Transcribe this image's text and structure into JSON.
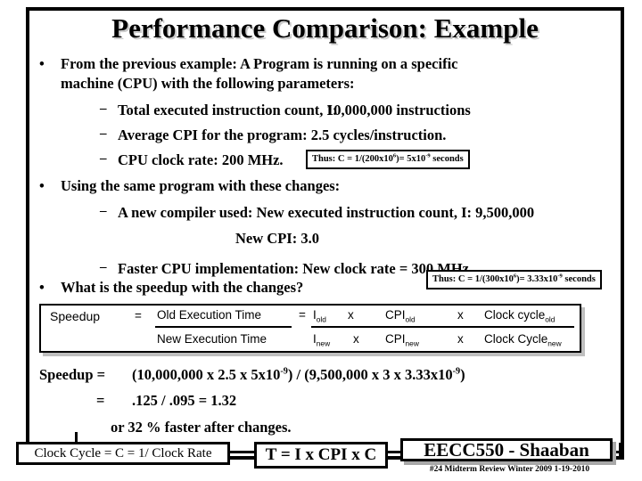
{
  "slide": {
    "title": "Performance Comparison: Example",
    "bullets": {
      "b1": "From the previous example:  A Program is running on a specific",
      "b1_line2": "machine (CPU) with the following parameters:",
      "d1": "Total executed instruction count, I:",
      "d1_value": "10,000,000 instructions",
      "d2": "Average CPI for the program:  2.5  cycles/instruction.",
      "d3": "CPU clock rate:  200 MHz.",
      "b2": "Using the same program with these changes:",
      "d4": "A new compiler used:  New executed instruction count, I:  9,500,000",
      "d4_line2": "New CPI:  3.0",
      "d5": "Faster CPU implementation:  New clock rate = 300 MHz",
      "b3": "What is the speedup with the changes?"
    },
    "dash": "–",
    "bullet_glyph": "•",
    "callouts": {
      "old_clock": {
        "prefix": "Thus: C = 1/(200x10",
        "exp1": "6",
        "mid": ")= 5x10",
        "exp2": "-9",
        "suffix": " seconds"
      },
      "new_clock": {
        "prefix": "Thus: C = 1/(300x10",
        "exp1": "6",
        "mid": ")= 3.33x10",
        "exp2": "-9",
        "suffix": " seconds"
      }
    },
    "speedup_formula": {
      "label": "Speedup",
      "equals1": "=",
      "num_text": "Old Execution Time",
      "den_text": "New Execution Time",
      "equals2": "=",
      "num_i": "I",
      "num_i_sub": "old",
      "x1": "x",
      "num_cpi": "CPI",
      "num_cpi_sub": "old",
      "x2": "x",
      "num_cc": "Clock cycle",
      "num_cc_sub": "old",
      "den_i": "I",
      "den_i_sub": "new",
      "x3": "x",
      "den_cpi": "CPI",
      "den_cpi_sub": "new",
      "x4": "x",
      "den_cc": "Clock Cycle",
      "den_cc_sub": "new"
    },
    "calc": {
      "line1_label": "Speedup  =",
      "line1_a": "(10,000,000  x   2.5  x  5x10",
      "line1_a_exp": "-9",
      "line1_b": ") / (9,500,000  x 3  x  3.33x10",
      "line1_b_exp": "-9",
      "line1_c": ")",
      "line2_label": "=",
      "line2_text": ".125 /  .095 = 1.32",
      "line3_text": "or 32 % faster after changes."
    },
    "footer": {
      "clock_cycle_box": "Clock Cycle = C = 1/ Clock Rate",
      "t_box": "T  =  I  x  CPI   x C",
      "course_box": "EECC550 - Shaaban",
      "footnote": "#24   Midterm Review   Winter 2009  1-19-2010"
    }
  },
  "colors": {
    "text": "#000000",
    "frame": "#000000",
    "title_shadow": "#c9c9c9",
    "box_shadow": "#bfbfbf"
  }
}
